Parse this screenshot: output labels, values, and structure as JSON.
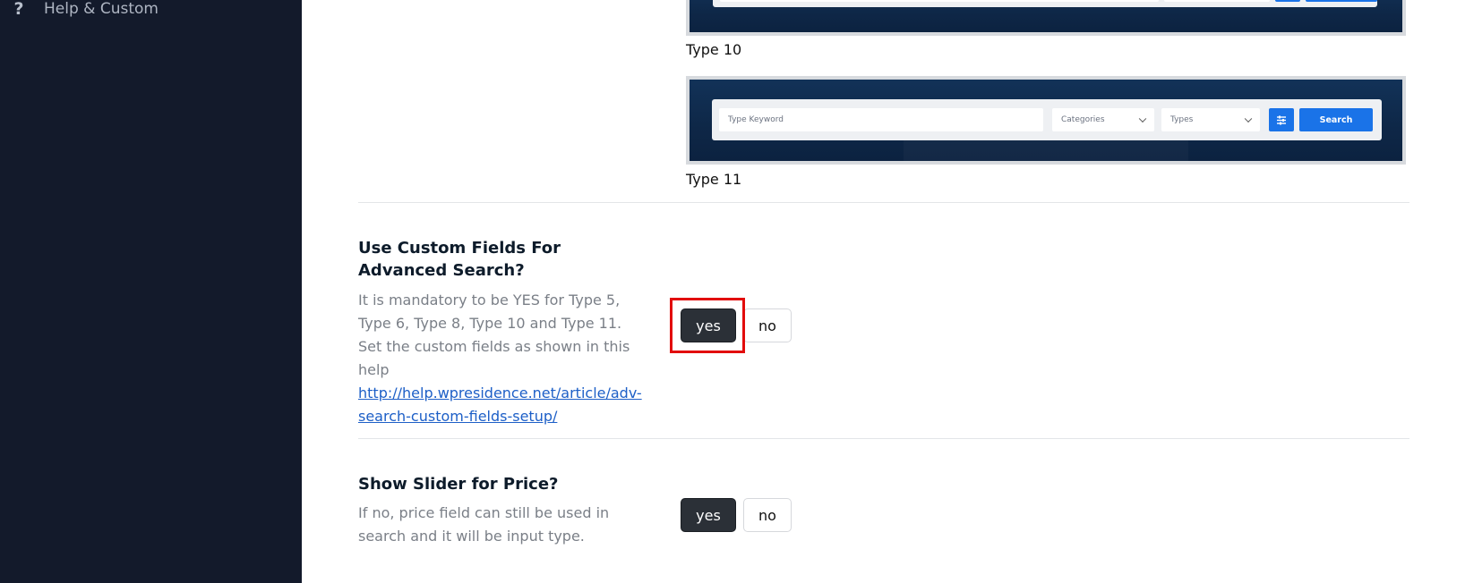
{
  "sidebar": {
    "items": [
      {
        "label": "Help & Custom",
        "icon": "help-question-icon"
      }
    ]
  },
  "previews": [
    {
      "caption": "Type 10",
      "search": {
        "keyword_placeholder": "",
        "categories": "",
        "types": "",
        "button": ""
      }
    },
    {
      "caption": "Type 11",
      "search": {
        "keyword_placeholder": "Type Keyword",
        "categories": "Categories",
        "types": "Types",
        "button": "Search"
      }
    }
  ],
  "options": [
    {
      "title": "Use Custom Fields For Advanced Search?",
      "description": "It is mandatory to be YES for Type 5, Type 6, Type 8, Type 10 and Type 11. Set the custom fields as shown in this help",
      "link": "http://help.wpresidence.net/article/adv-search-custom-fields-setup/",
      "yes_label": "yes",
      "no_label": "no",
      "selected": "yes"
    },
    {
      "title": "Show Slider for Price?",
      "description": "If no, price field can still be used in search and it will be input type.",
      "yes_label": "yes",
      "no_label": "no",
      "selected": "yes"
    }
  ],
  "colors": {
    "sidebar_bg": "#131a2b",
    "accent_blue": "#1a73e8",
    "toggle_on": "#2b3037",
    "highlight": "#e20c0c"
  }
}
